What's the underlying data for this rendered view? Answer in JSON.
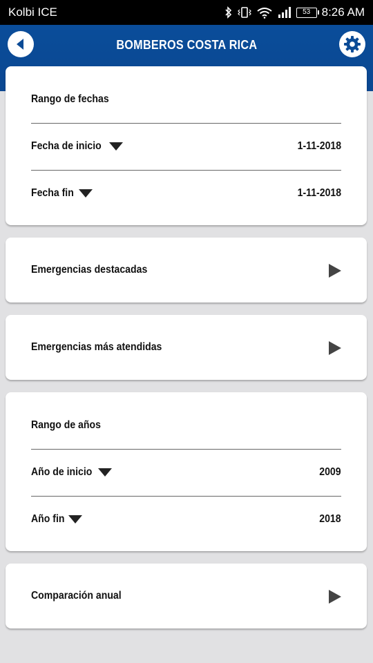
{
  "status_bar": {
    "carrier": "Kolbi ICE",
    "battery": "53",
    "time": "8:26 AM"
  },
  "header": {
    "title": "BOMBEROS COSTA RICA"
  },
  "date_range": {
    "title": "Rango de fechas",
    "start_label": "Fecha de inicio",
    "start_value": "1-11-2018",
    "end_label": "Fecha fin",
    "end_value": "1-11-2018"
  },
  "menu": {
    "featured": "Emergencias destacadas",
    "most_attended": "Emergencias más atendidas"
  },
  "year_range": {
    "title": "Rango de años",
    "start_label": "Año de inicio",
    "start_value": "2009",
    "end_label": "Año fin",
    "end_value": "2018"
  },
  "annual": {
    "label": "Comparación anual"
  },
  "colors": {
    "primary": "#0b4b96",
    "background": "#e1e1e3"
  }
}
